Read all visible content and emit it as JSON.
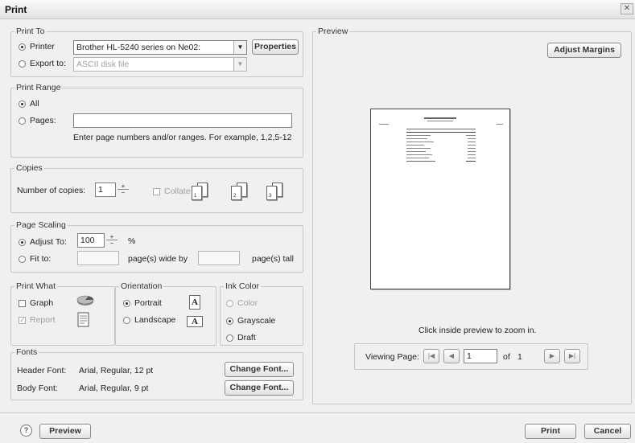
{
  "window": {
    "title": "Print",
    "close": "✕"
  },
  "print_to": {
    "legend": "Print To",
    "printer_label": "Printer",
    "printer_value": "Brother HL-5240 series on Ne02:",
    "properties_label": "Properties",
    "export_label": "Export to:",
    "export_value": "ASCII disk file"
  },
  "print_range": {
    "legend": "Print Range",
    "all_label": "All",
    "pages_label": "Pages:",
    "pages_value": "",
    "hint": "Enter page numbers and/or ranges. For example, 1,2,5-12"
  },
  "copies": {
    "legend": "Copies",
    "number_label": "Number of copies:",
    "number_value": "1",
    "collate_label": "Collate",
    "collate_icons": [
      "1",
      "2",
      "3"
    ]
  },
  "page_scaling": {
    "legend": "Page Scaling",
    "adjust_label": "Adjust To:",
    "adjust_value": "100",
    "percent": "%",
    "fit_label": "Fit to:",
    "wide_label": "page(s) wide by",
    "tall_label": "page(s) tall"
  },
  "print_what": {
    "legend": "Print What",
    "graph_label": "Graph",
    "report_label": "Report"
  },
  "orientation": {
    "legend": "Orientation",
    "portrait_label": "Portrait",
    "landscape_label": "Landscape",
    "icon_letter": "A"
  },
  "ink_color": {
    "legend": "Ink Color",
    "color_label": "Color",
    "grayscale_label": "Grayscale",
    "draft_label": "Draft"
  },
  "fonts": {
    "legend": "Fonts",
    "header_label": "Header Font:",
    "header_value": "Arial, Regular, 12 pt",
    "body_label": "Body Font:",
    "body_value": "Arial, Regular, 9 pt",
    "change_label": "Change Font..."
  },
  "preview": {
    "legend": "Preview",
    "adjust_margins_label": "Adjust Margins",
    "zoom_hint": "Click inside preview to zoom in.",
    "viewing_label": "Viewing Page:",
    "page_value": "1",
    "of_label": "of",
    "total_pages": "1"
  },
  "footer": {
    "help_icon": "?",
    "preview_label": "Preview",
    "print_label": "Print",
    "cancel_label": "Cancel"
  },
  "colors": {
    "dialog_bg": "#f0f0f0",
    "border": "#c7c7c7",
    "button_text": "#333333"
  }
}
